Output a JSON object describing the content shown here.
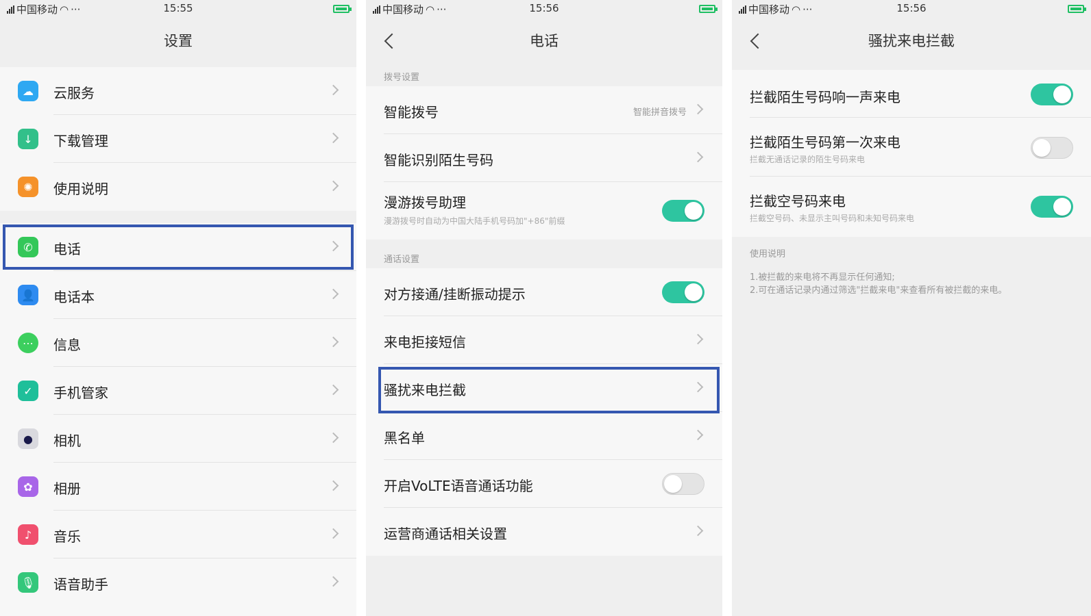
{
  "colors": {
    "accent_toggle": "#2ec5a0",
    "highlight_border": "#3557b0",
    "battery": "#1fbf63"
  },
  "screen1": {
    "status": {
      "carrier": "中国移动",
      "time": "15:55",
      "dots": "···"
    },
    "title": "设置",
    "group1": [
      {
        "label": "云服务",
        "icon": "cloud-icon",
        "color": "#2ea8f2"
      },
      {
        "label": "下载管理",
        "icon": "download-icon",
        "color": "#32c08a"
      },
      {
        "label": "使用说明",
        "icon": "bulb-icon",
        "color": "#f5922a"
      }
    ],
    "group2": [
      {
        "label": "电话",
        "icon": "phone-icon",
        "color": "#34c759"
      },
      {
        "label": "电话本",
        "icon": "contacts-icon",
        "color": "#2e8bf0"
      },
      {
        "label": "信息",
        "icon": "message-icon",
        "color": "#3ccf5e"
      },
      {
        "label": "手机管家",
        "icon": "shield-icon",
        "color": "#1fbf9a"
      },
      {
        "label": "相机",
        "icon": "camera-icon",
        "color": "#d9d9de"
      },
      {
        "label": "相册",
        "icon": "gallery-icon",
        "color": "#a866e8"
      },
      {
        "label": "音乐",
        "icon": "music-icon",
        "color": "#f0506e"
      },
      {
        "label": "语音助手",
        "icon": "mic-icon",
        "color": "#34c77b"
      }
    ]
  },
  "screen2": {
    "status": {
      "carrier": "中国移动",
      "time": "15:56",
      "dots": "···"
    },
    "title": "电话",
    "section1": "拨号设置",
    "items1": [
      {
        "label": "智能拨号",
        "value": "智能拼音拨号"
      },
      {
        "label": "智能识别陌生号码"
      },
      {
        "label": "漫游拨号助理",
        "sub": "漫游拨号时自动为中国大陆手机号码加\"+86\"前缀",
        "toggle": "on"
      }
    ],
    "section2": "通话设置",
    "items2": [
      {
        "label": "对方接通/挂断振动提示",
        "toggle": "on"
      },
      {
        "label": "来电拒接短信"
      },
      {
        "label": "骚扰来电拦截"
      },
      {
        "label": "黑名单"
      },
      {
        "label": "开启VoLTE语音通话功能",
        "toggle": "off"
      },
      {
        "label": "运营商通话相关设置"
      }
    ]
  },
  "screen3": {
    "status": {
      "carrier": "中国移动",
      "time": "15:56",
      "dots": "···"
    },
    "title": "骚扰来电拦截",
    "items": [
      {
        "label": "拦截陌生号码响一声来电",
        "toggle": "on"
      },
      {
        "label": "拦截陌生号码第一次来电",
        "sub": "拦截无通话记录的陌生号码来电",
        "toggle": "off"
      },
      {
        "label": "拦截空号码来电",
        "sub": "拦截空号码、未显示主叫号码和未知号码来电",
        "toggle": "on"
      }
    ],
    "note_title": "使用说明",
    "note_lines": [
      "1.被拦截的来电将不再显示任何通知;",
      "2.可在通话记录内通过筛选\"拦截来电\"来查看所有被拦截的来电。"
    ]
  }
}
